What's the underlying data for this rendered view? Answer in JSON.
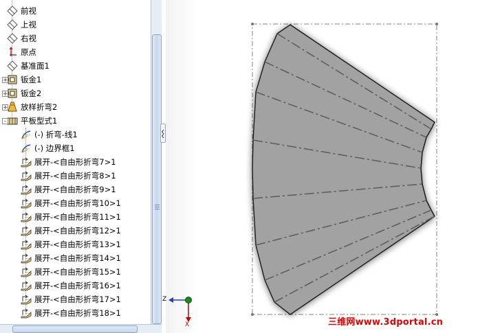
{
  "tree": {
    "items": [
      {
        "label": "前视",
        "icon": "plane-icon",
        "indent": 0
      },
      {
        "label": "上视",
        "icon": "plane-icon",
        "indent": 0
      },
      {
        "label": "右视",
        "icon": "plane-icon",
        "indent": 0
      },
      {
        "label": "原点",
        "icon": "origin-icon",
        "indent": 0
      },
      {
        "label": "基准面1",
        "icon": "plane-icon",
        "indent": 0
      },
      {
        "label": "钣金1",
        "icon": "sheet-metal-icon",
        "indent": 0
      },
      {
        "label": "钣金2",
        "icon": "sheet-metal-icon",
        "indent": 0
      },
      {
        "label": "放样折弯2",
        "icon": "lofted-bend-icon",
        "indent": 0
      },
      {
        "label": "平板型式1",
        "icon": "flat-pattern-icon",
        "indent": 0
      },
      {
        "label": "(-) 折弯-线1",
        "icon": "sketch-icon",
        "indent": 1
      },
      {
        "label": "(-) 边界框1",
        "icon": "sketch-icon",
        "indent": 1
      },
      {
        "label": "展开-<自由形折弯7>1",
        "icon": "unfold-icon",
        "indent": 1
      },
      {
        "label": "展开-<自由形折弯8>1",
        "icon": "unfold-icon",
        "indent": 1
      },
      {
        "label": "展开-<自由形折弯9>1",
        "icon": "unfold-icon",
        "indent": 1
      },
      {
        "label": "展开-<自由形折弯10>1",
        "icon": "unfold-icon",
        "indent": 1
      },
      {
        "label": "展开-<自由形折弯11>1",
        "icon": "unfold-icon",
        "indent": 1
      },
      {
        "label": "展开-<自由形折弯12>1",
        "icon": "unfold-icon",
        "indent": 1
      },
      {
        "label": "展开-<自由形折弯13>1",
        "icon": "unfold-icon",
        "indent": 1
      },
      {
        "label": "展开-<自由形折弯14>1",
        "icon": "unfold-icon",
        "indent": 1
      },
      {
        "label": "展开-<自由形折弯15>1",
        "icon": "unfold-icon",
        "indent": 1
      },
      {
        "label": "展开-<自由形折弯16>1",
        "icon": "unfold-icon",
        "indent": 1
      },
      {
        "label": "展开-<自由形折弯17>1",
        "icon": "unfold-icon",
        "indent": 1
      },
      {
        "label": "展开-<自由形折弯18>1",
        "icon": "unfold-icon",
        "indent": 1
      }
    ]
  },
  "triad": {
    "z_label": "Z",
    "x_label": "X"
  },
  "watermark": "三维网www.3dportal.cn",
  "colors": {
    "part_fill": "#a2a2a2",
    "edge": "#1a1a1a",
    "bend_line": "#5e5e5e",
    "bbox": "#808080",
    "watermark": "#e60000"
  }
}
